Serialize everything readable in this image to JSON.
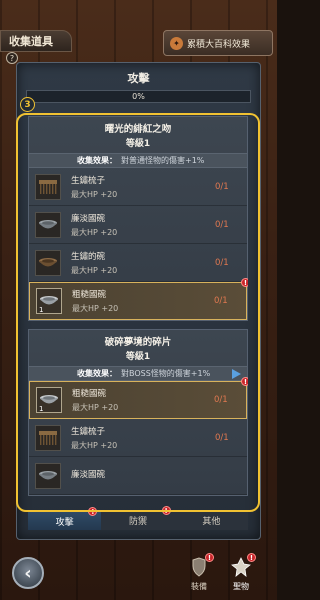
{
  "window": {
    "title": "收集道具",
    "info_icon": "?"
  },
  "collection_button": {
    "label": "累積大百科效果",
    "icon": "book-icon"
  },
  "category": {
    "title": "攻擊",
    "progress_text": "0%",
    "progress": 0
  },
  "step_badge": "3",
  "sets": [
    {
      "name": "曙光的緋紅之吻",
      "level": "等級1",
      "effect_label": "收集效果：",
      "effect_value": "對普通怪物的傷害+1%",
      "items": [
        {
          "name": "生鏽梳子",
          "stat": "最大HP +20",
          "count": "0/1",
          "icon": "comb-icon",
          "selected": false,
          "qty": ""
        },
        {
          "name": "廉淡國碗",
          "stat": "最大HP +20",
          "count": "0/1",
          "icon": "bowl-icon",
          "selected": false,
          "qty": ""
        },
        {
          "name": "生鏽的碗",
          "stat": "最大HP +20",
          "count": "0/1",
          "icon": "bowl-icon",
          "selected": false,
          "qty": ""
        },
        {
          "name": "粗糙國碗",
          "stat": "最大HP +20",
          "count": "0/1",
          "icon": "bowl-icon",
          "selected": true,
          "qty": "1"
        }
      ]
    },
    {
      "name": "破碎夢境的碎片",
      "level": "等級1",
      "effect_label": "收集效果：",
      "effect_value": "對BOSS怪物的傷害+1%",
      "items": [
        {
          "name": "粗糙國碗",
          "stat": "最大HP +20",
          "count": "0/1",
          "icon": "bowl-icon",
          "selected": true,
          "qty": "1"
        },
        {
          "name": "生鏽梳子",
          "stat": "最大HP +20",
          "count": "0/1",
          "icon": "comb-icon",
          "selected": false,
          "qty": ""
        },
        {
          "name": "廉淡國碗",
          "stat": "",
          "count": "",
          "icon": "bowl-icon",
          "selected": false,
          "qty": ""
        }
      ]
    }
  ],
  "tabs": [
    {
      "label": "攻擊",
      "active": true
    },
    {
      "label": "防禦",
      "active": false
    },
    {
      "label": "其他",
      "active": false
    }
  ],
  "nav": {
    "back_icon": "back-arrow-icon",
    "items": [
      {
        "label": "裝備",
        "icon": "armor-icon"
      },
      {
        "label": "聖物",
        "icon": "relic-icon"
      }
    ]
  },
  "colors": {
    "highlight": "#f1c232",
    "count_red": "#e07850",
    "active_tab": "#2f4a66"
  }
}
